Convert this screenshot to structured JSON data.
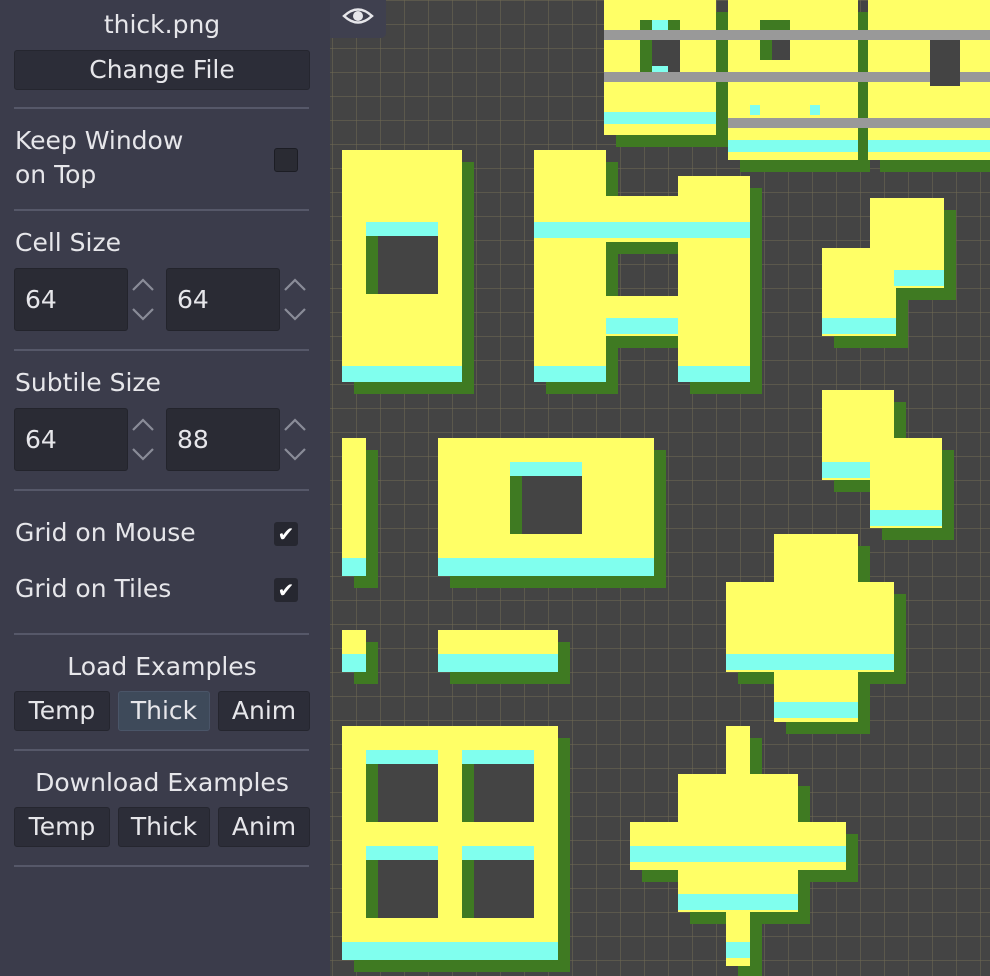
{
  "file": {
    "name": "thick.png",
    "change_label": "Change File"
  },
  "keep_on_top": {
    "line1": "Keep Window",
    "line2": "on Top",
    "checked": false
  },
  "cell_size": {
    "label": "Cell Size",
    "x": "64",
    "y": "64"
  },
  "subtile_size": {
    "label": "Subtile Size",
    "x": "64",
    "y": "88"
  },
  "grid_mouse": {
    "label": "Grid on Mouse",
    "checked": true,
    "mark": "✔"
  },
  "grid_tiles": {
    "label": "Grid on Tiles",
    "checked": true,
    "mark": "✔"
  },
  "load_examples": {
    "label": "Load Examples",
    "buttons": [
      "Temp",
      "Thick",
      "Anim"
    ],
    "selected": "Thick"
  },
  "download_examples": {
    "label": "Download Examples",
    "buttons": [
      "Temp",
      "Thick",
      "Anim"
    ]
  },
  "icons": {
    "preview_toggle": "eye-icon",
    "spin_arrows": "chevron-up-down-icon"
  },
  "colors": {
    "sidebar_bg": "#3b3c4b",
    "viewport_bg": "#444444",
    "grid_line": "#7a7256",
    "tile_yellow": "#ffff66",
    "tile_cyan": "#80ffee",
    "tile_shadow": "#3f7a22",
    "tile_gray": "#999999"
  }
}
